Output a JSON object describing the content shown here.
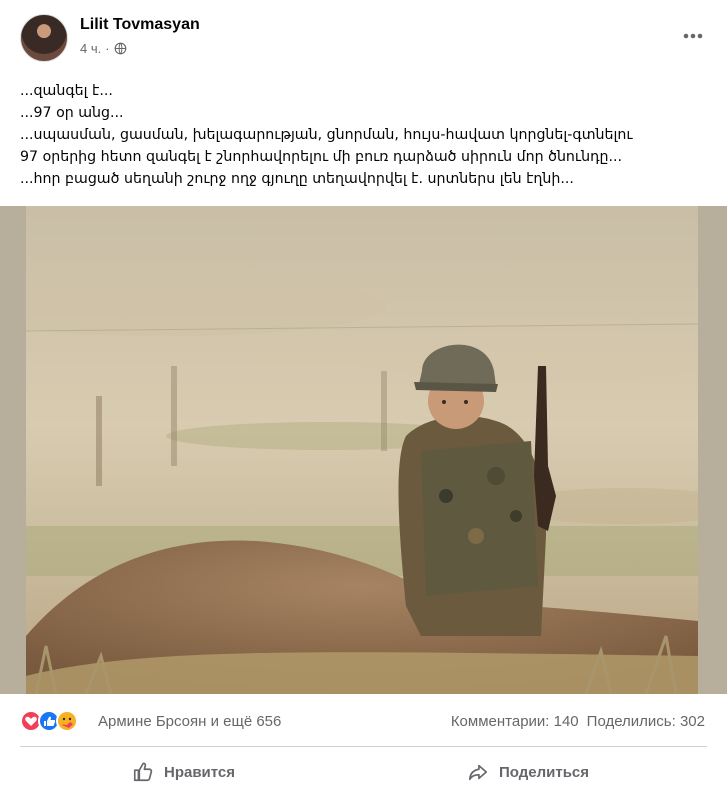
{
  "post": {
    "author": "Lilit Tovmasyan",
    "time": "4 ч.",
    "lines": [
      "...զանգել է...",
      "...97 օր անց...",
      "...սպասման, ցասման, խելագարության, ցնորման, հույս-հավատ կորցնել-գտնելու",
      "97 օրերից հետո զանգել է շնորհավորելու մի բուռ դարձած սիրուն մոր ծնունդը...",
      "...հոր բացած սեղանի շուրջ ողջ գյուղը տեղավորվել է. սրտներս լեն էղնի..."
    ]
  },
  "reactions": {
    "names": "Армине Брсоян и ещё 656",
    "comments": "Комментарии: 140",
    "shares": "Поделились: 302"
  },
  "actions": {
    "like": "Нравится",
    "share": "Поделиться"
  },
  "icons": {
    "globe": "globe-icon",
    "more": "more-horizontal-icon",
    "like": "thumbs-up-icon",
    "share": "share-arrow-icon",
    "reactions": [
      "love-icon",
      "like-icon",
      "care-icon"
    ]
  },
  "colors": {
    "like_blue": "#1877f2",
    "love_red": "#f33e58",
    "care_yellow": "#f7b125",
    "secondary_text": "#65676b"
  }
}
